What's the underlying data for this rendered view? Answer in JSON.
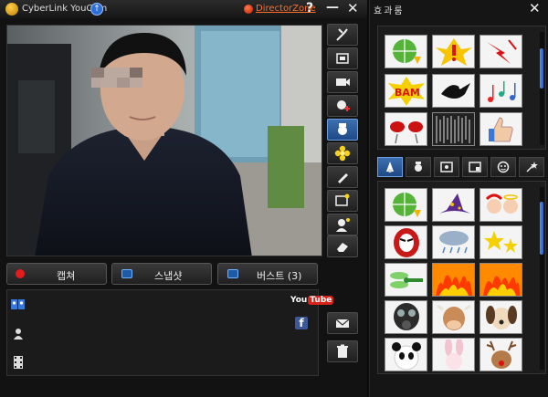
{
  "titlebar": {
    "app_title": "CyberLink YouCam",
    "director_zone": "DirectorZone",
    "help": "?",
    "minimize": "—",
    "close": "✕"
  },
  "capture": {
    "capture_label": "캡쳐",
    "snapshot_label": "스냅샷",
    "burst_label": "버스트 (3)"
  },
  "share": {
    "youtube_you": "You",
    "youtube_tube": "Tube",
    "facebook": "f"
  },
  "effects": {
    "title": "효과룸",
    "close": "✕"
  },
  "colors": {
    "accent": "#2f66b8",
    "director_zone": "#ff6e2a",
    "record": "#e41c1c"
  },
  "icons": {
    "tools": [
      "settings-icon",
      "fullscreen-icon",
      "webcam-icon",
      "avatar-add-icon",
      "effects-icon",
      "flower-icon",
      "pen-icon",
      "scene-icon",
      "face-tracking-icon",
      "eraser-icon"
    ],
    "library": [
      "photo-icon",
      "avatar-icon",
      "film-icon"
    ],
    "side": [
      "mail-icon",
      "trash-icon"
    ],
    "effect_tabs": [
      "wizard-icon",
      "avatar-icon",
      "frame-icon",
      "scene-icon",
      "emotion-icon",
      "particle-icon"
    ]
  }
}
